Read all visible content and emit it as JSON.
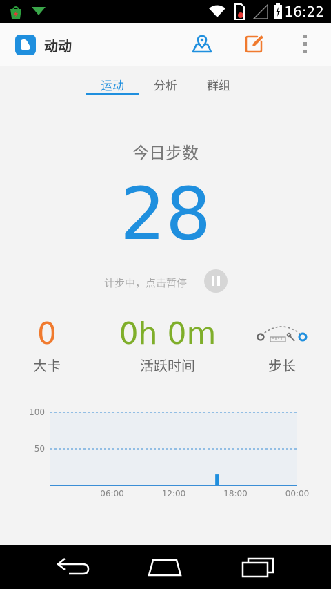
{
  "status_bar": {
    "time": "16:22"
  },
  "app_bar": {
    "title": "动动",
    "icons": [
      "map-icon",
      "edit-icon",
      "overflow-menu-icon"
    ],
    "accent": "#1f8fde",
    "edit_color": "#f07a2e"
  },
  "tabs": [
    {
      "label": "运动",
      "active": true
    },
    {
      "label": "分析",
      "active": false
    },
    {
      "label": "群组",
      "active": false
    }
  ],
  "steps": {
    "label": "今日步数",
    "value": "28",
    "status_text": "计步中，点击暂停"
  },
  "metrics": {
    "calories": {
      "value": "0",
      "label": "大卡",
      "color": "#f07a2e"
    },
    "active_time": {
      "value": "0h 0m",
      "label": "活跃时间",
      "color": "#7fae2a"
    },
    "stride": {
      "label": "步长"
    }
  },
  "chart_data": {
    "type": "bar",
    "y_ticks": [
      "100",
      "50"
    ],
    "x_ticks": [
      "06:00",
      "12:00",
      "18:00",
      "00:00"
    ],
    "ylim": [
      0,
      100
    ],
    "xlim_hours": [
      0,
      24
    ],
    "values": [
      {
        "hour": 16.2,
        "value": 15
      }
    ],
    "grid": true
  },
  "nav_bar": {
    "icons": [
      "back-icon",
      "home-icon",
      "recent-apps-icon"
    ]
  }
}
